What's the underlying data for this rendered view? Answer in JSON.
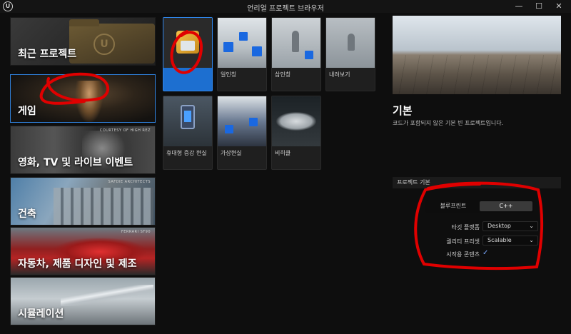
{
  "window": {
    "title": "언리얼 프로젝트 브라우저",
    "logo_glyph": "U",
    "minimize_glyph": "—",
    "maximize_glyph": "☐",
    "close_glyph": "✕"
  },
  "categories": [
    {
      "label": "최근 프로젝트",
      "badge": ""
    },
    {
      "label": "게임",
      "badge": ""
    },
    {
      "label": "영화, TV 및 라이브 이벤트",
      "badge": "COURTESY OF HIGH REZ"
    },
    {
      "label": "건축",
      "badge": "SAFDIE ARCHITECTS"
    },
    {
      "label": "자동차, 제품 디자인 및 제조",
      "badge": "FERRARI SF90"
    },
    {
      "label": "시뮬레이션",
      "badge": ""
    }
  ],
  "templates": [
    {
      "name": ""
    },
    {
      "name": "일인칭"
    },
    {
      "name": "삼인칭"
    },
    {
      "name": "내려보기"
    },
    {
      "name": "휴대형 증강 현실"
    },
    {
      "name": "가상현실"
    },
    {
      "name": "비히클"
    }
  ],
  "detail": {
    "title": "기본",
    "description": "코드가 포함되지 않은 기본 빈 프로젝트입니다.",
    "defaults_header": "프로젝트 기본",
    "language_options": [
      "블루프린트",
      "C++"
    ],
    "selected_language": "C++",
    "target_platform_label": "타깃 플랫폼",
    "target_platform_value": "Desktop",
    "quality_preset_label": "퀄리티 프리셋",
    "quality_preset_value": "Scalable",
    "starter_content_label": "시작용 콘텐츠",
    "starter_content_checked": true,
    "check_glyph": "✓",
    "chevron_glyph": "⌄",
    "ue_glyph": "U"
  },
  "colors": {
    "selection_blue": "#1d6fd0",
    "annotation_red": "#e00000"
  }
}
